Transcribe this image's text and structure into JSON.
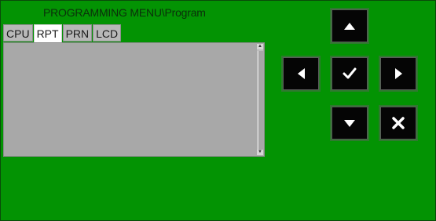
{
  "title": "PROGRAMMING MENU\\Program",
  "tabs": [
    {
      "label": "CPU",
      "active": false
    },
    {
      "label": "RPT",
      "active": true
    },
    {
      "label": "PRN",
      "active": false
    },
    {
      "label": "LCD",
      "active": false
    }
  ],
  "buttons": {
    "up": "up-arrow-icon",
    "left": "left-arrow-icon",
    "ok": "checkmark-icon",
    "right": "right-arrow-icon",
    "down": "down-arrow-icon",
    "cancel": "x-mark-icon"
  },
  "colors": {
    "panel_bg": "#039303",
    "button_bg": "#050505",
    "listbox_bg": "#a8a8a8",
    "active_tab_bg": "#ffffff"
  }
}
